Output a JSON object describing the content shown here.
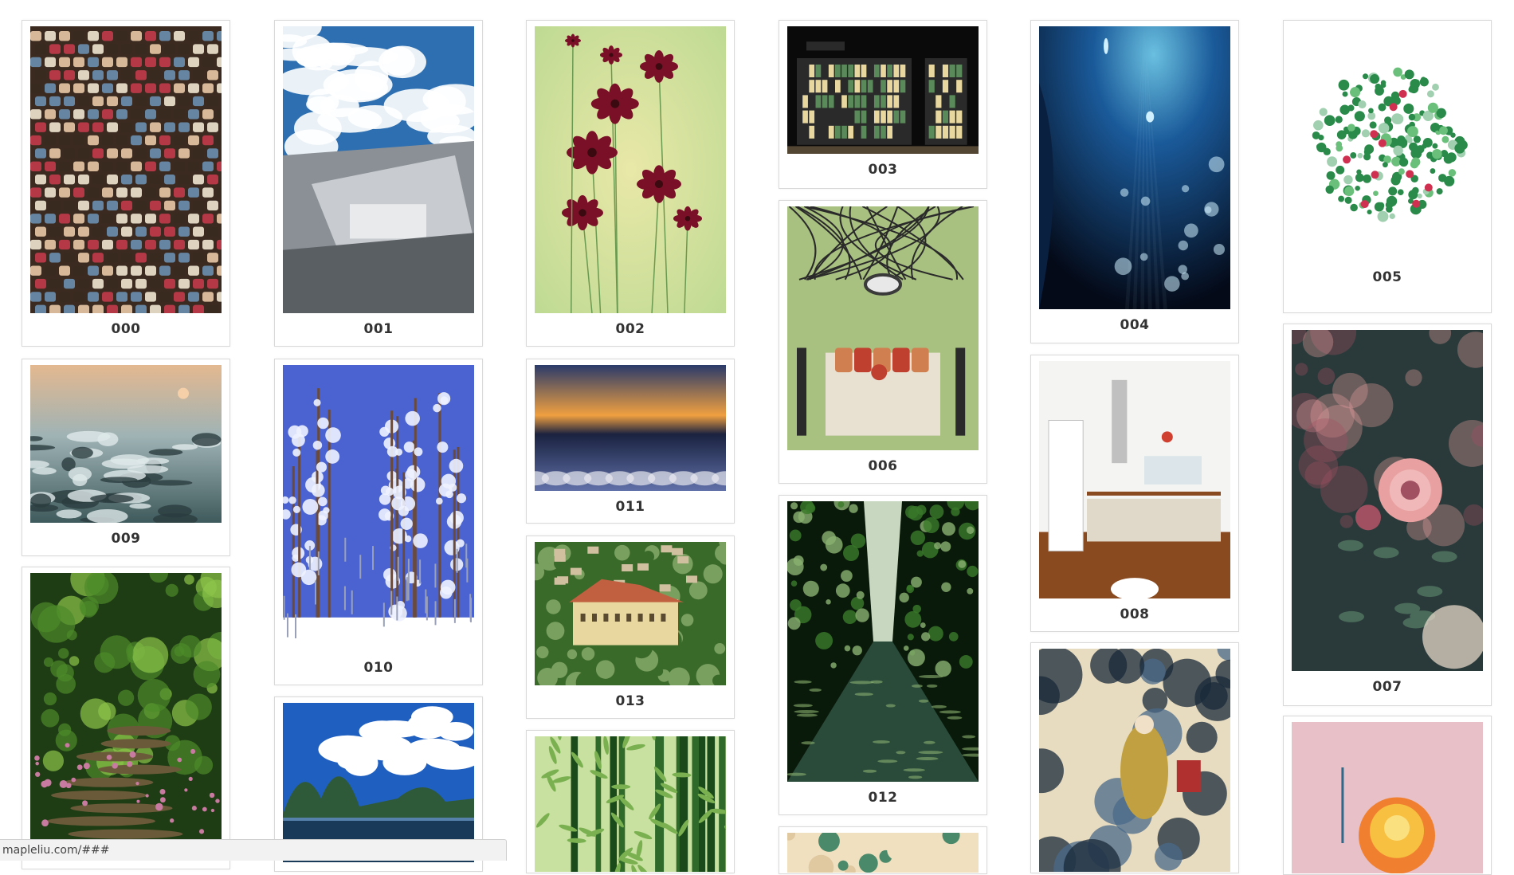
{
  "status_bar": {
    "url": "mapleliu.com/###"
  },
  "columns": [
    [
      {
        "label": "000",
        "scene": "ribbon-spools",
        "palette": [
          "#3a2a20",
          "#c23a4a",
          "#e9c9a6",
          "#6a8fb0",
          "#f0e5d0"
        ]
      },
      {
        "label": "009",
        "scene": "snowy-marsh-sunset",
        "palette": [
          "#e3b890",
          "#9fb3b5",
          "#3f5a5c",
          "#dfe8ea",
          "#2b3c3e"
        ]
      },
      {
        "label": "",
        "scene": "forest-stone-path",
        "palette": [
          "#1f3d14",
          "#4d8a2a",
          "#8dc44a",
          "#c97aa0",
          "#6b5a3a"
        ]
      }
    ],
    [
      {
        "label": "001",
        "scene": "rooftops-under-clouds",
        "palette": [
          "#2d6fb0",
          "#ffffff",
          "#8a9096",
          "#c8ccd0",
          "#5a5f64"
        ]
      },
      {
        "label": "010",
        "scene": "frosted-trees",
        "palette": [
          "#4a63d0",
          "#eef2ff",
          "#6a4a3a",
          "#ffffff",
          "#9aa0b8"
        ]
      },
      {
        "label": "",
        "scene": "karst-river",
        "palette": [
          "#1f5fc0",
          "#ffffff",
          "#2f5a3a",
          "#1a3a5a",
          "#7fb0e0"
        ]
      }
    ],
    [
      {
        "label": "002",
        "scene": "red-cosmos-flowers",
        "palette": [
          "#b8d890",
          "#e9e8a8",
          "#7a1028",
          "#6a9a50",
          "#f0e0a0"
        ]
      },
      {
        "label": "011",
        "scene": "winter-sunset-lake",
        "palette": [
          "#2a3a6a",
          "#f0a040",
          "#1a2240",
          "#e8e8f0",
          "#6070a8"
        ]
      },
      {
        "label": "013",
        "scene": "castle-on-hill",
        "palette": [
          "#3a6a2a",
          "#c06040",
          "#e8d8a0",
          "#7aa060",
          "#d0c0a0"
        ]
      },
      {
        "label": "",
        "scene": "bamboo-grove",
        "palette": [
          "#1a4a1a",
          "#7ab050",
          "#c8e0a0",
          "#2f6a2a",
          "#e0f0c0"
        ]
      }
    ],
    [
      {
        "label": "003",
        "scene": "bookshop-at-night",
        "palette": [
          "#0a0a0a",
          "#e8d8a0",
          "#5a8a5a",
          "#2a2a2a",
          "#c0a070"
        ]
      },
      {
        "label": "006",
        "scene": "green-bedroom",
        "palette": [
          "#a8c080",
          "#c04030",
          "#e8e0d0",
          "#2a2a2a",
          "#d08050"
        ]
      },
      {
        "label": "012",
        "scene": "canyon-stream",
        "palette": [
          "#0a1a0a",
          "#3a7a2a",
          "#8ab070",
          "#c8d8c0",
          "#2a4a3a"
        ]
      },
      {
        "label": "",
        "scene": "illustration-flowers",
        "palette": [
          "#e0c8a0",
          "#c04060",
          "#4a8a6a",
          "#f0e0c0",
          "#2a4a6a"
        ]
      }
    ],
    [
      {
        "label": "004",
        "scene": "underwater-diver",
        "palette": [
          "#040a18",
          "#1a5a9a",
          "#6ac0e0",
          "#0a2040",
          "#d0f0ff"
        ]
      },
      {
        "label": "008",
        "scene": "white-kitchen",
        "palette": [
          "#f4f4f2",
          "#8a4a20",
          "#c0c0c0",
          "#e0d8c8",
          "#d04030"
        ]
      },
      {
        "label": "",
        "scene": "ink-dragon-art",
        "palette": [
          "#e8dcc0",
          "#1a2a3a",
          "#4a6a8a",
          "#c0a040",
          "#b03030"
        ]
      }
    ],
    [
      {
        "label": "005",
        "scene": "clover-wreath",
        "palette": [
          "#ffffff",
          "#2a8a4a",
          "#6ac07a",
          "#d03050",
          "#a0d0b0"
        ]
      },
      {
        "label": "007",
        "scene": "pink-rose-bokeh",
        "palette": [
          "#2a3a3a",
          "#e8a0a0",
          "#4a6a5a",
          "#f0e0d0",
          "#a05060"
        ]
      },
      {
        "label": "",
        "scene": "yellow-rose-pink-bg",
        "palette": [
          "#e8c0c8",
          "#f8c040",
          "#f08030",
          "#2a6a8a",
          "#f8e8e0"
        ]
      }
    ]
  ]
}
